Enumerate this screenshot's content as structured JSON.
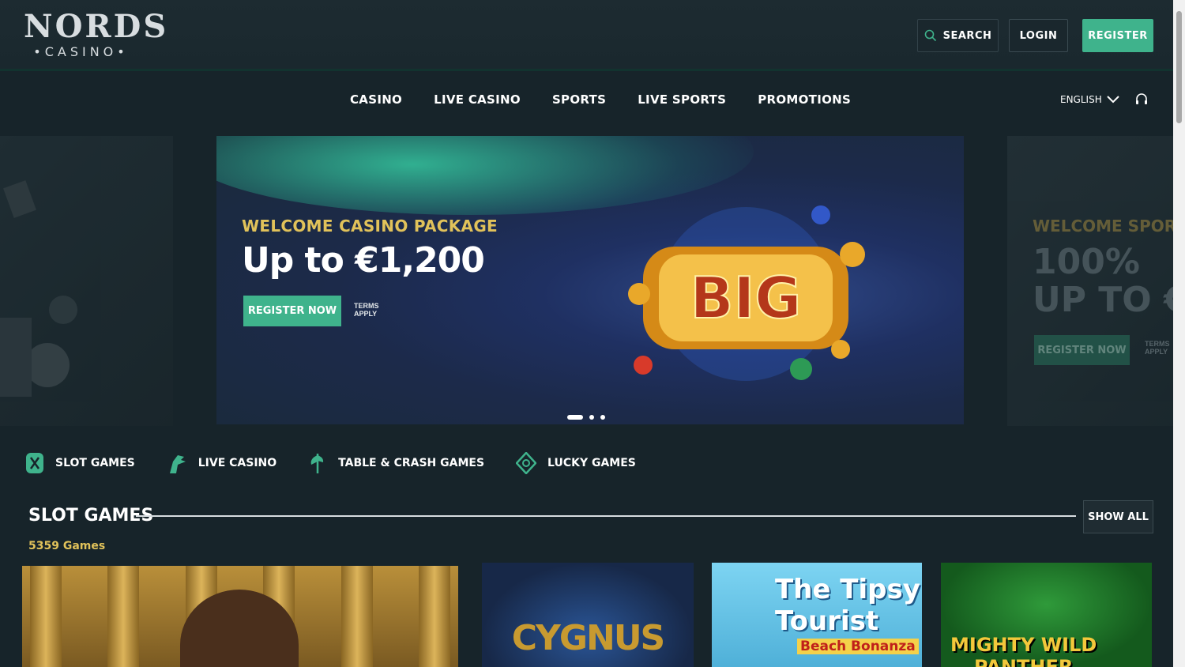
{
  "brand": {
    "logo_main": "NORDS",
    "logo_sub": "•CASINO•"
  },
  "header": {
    "search_label": "SEARCH",
    "login_label": "LOGIN",
    "register_label": "REGISTER"
  },
  "nav": {
    "items": [
      "CASINO",
      "LIVE CASINO",
      "SPORTS",
      "LIVE SPORTS",
      "PROMOTIONS"
    ],
    "language": "ENGLISH"
  },
  "carousel": {
    "active_slide": {
      "subtitle": "WELCOME CASINO PACKAGE",
      "headline": "Up to €1,200",
      "cta": "REGISTER NOW",
      "terms_line1": "TERMS",
      "terms_line2": "APPLY"
    },
    "next_slide": {
      "subtitle": "WELCOME SPORTS B",
      "headline_line1": "100%",
      "headline_line2": "UP TO €",
      "cta": "REGISTER NOW",
      "terms_line1": "TERMS",
      "terms_line2": "APPLY"
    },
    "dots": 3,
    "active_dot": 0
  },
  "categories": [
    "SLOT GAMES",
    "LIVE CASINO",
    "TABLE & CRASH GAMES",
    "LUCKY GAMES"
  ],
  "section": {
    "title": "SLOT GAMES",
    "show_all": "SHOW ALL",
    "count": "5359 Games"
  },
  "games": {
    "cygnus": "CYGNUS",
    "tipsy_line1": "The Tipsy",
    "tipsy_line2": "Tourist",
    "tipsy_sub": "Beach Bonanza",
    "panther_line1": "MIGHTY WILD",
    "panther_line2": "PANTHER"
  },
  "colors": {
    "accent": "#3fb38c",
    "gold": "#e1c25a",
    "bg": "#17242a"
  }
}
